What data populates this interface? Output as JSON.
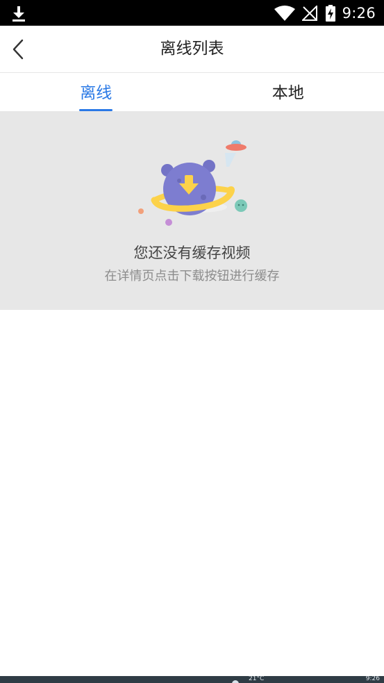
{
  "status_bar": {
    "time": "9:26",
    "icons": [
      "download-icon",
      "wifi-icon",
      "no-sim-icon",
      "battery-charging-icon"
    ]
  },
  "header": {
    "title": "离线列表",
    "back_icon": "chevron-left-icon"
  },
  "tabs": [
    {
      "label": "离线",
      "active": true
    },
    {
      "label": "本地",
      "active": false
    }
  ],
  "empty_state": {
    "title": "您还没有缓存视频",
    "hint": "在详情页点击下载按钮进行缓存",
    "illustration": "planet-download-illustration"
  },
  "taskbar": {
    "temperature": "21°C",
    "time": "9:26"
  },
  "colors": {
    "accent": "#2a79e6",
    "empty_bg": "#e7e7e7",
    "planet": "#7d7dd0",
    "ring": "#fcd24a"
  }
}
